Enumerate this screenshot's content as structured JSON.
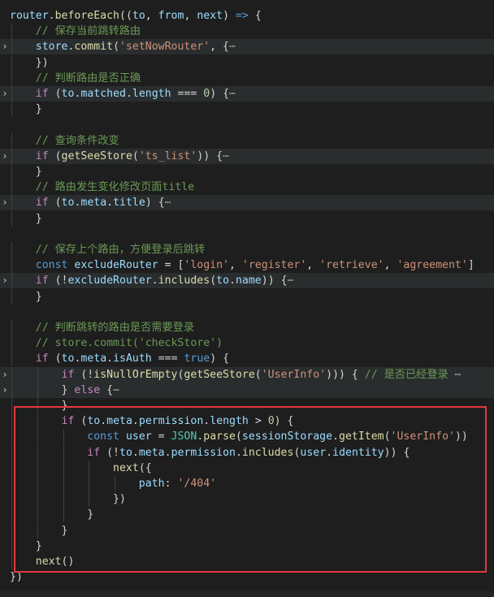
{
  "editor": {
    "lines": [
      {
        "tokens": [
          [
            "var",
            "router"
          ],
          [
            "pun",
            "."
          ],
          [
            "fn",
            "beforeEach"
          ],
          [
            "pun",
            "(("
          ],
          [
            "var",
            "to"
          ],
          [
            "pun",
            ", "
          ],
          [
            "var",
            "from"
          ],
          [
            "pun",
            ", "
          ],
          [
            "var",
            "next"
          ],
          [
            "pun",
            ") "
          ],
          [
            "kw",
            "=>"
          ],
          [
            "pun",
            " {"
          ]
        ]
      },
      {
        "tokens": [
          [
            "pun",
            "  "
          ],
          [
            "com",
            "// 保存当前跳转路由"
          ]
        ]
      },
      {
        "folded": true,
        "tokens": [
          [
            "pun",
            "  "
          ],
          [
            "var",
            "store"
          ],
          [
            "pun",
            "."
          ],
          [
            "fn",
            "commit"
          ],
          [
            "pun",
            "("
          ],
          [
            "str",
            "'setNowRouter'"
          ],
          [
            "pun",
            ", {"
          ],
          [
            "ell",
            "⋯"
          ]
        ]
      },
      {
        "tokens": [
          [
            "pun",
            "  })"
          ]
        ]
      },
      {
        "tokens": [
          [
            "pun",
            "  "
          ],
          [
            "com",
            "// 判断路由是否正确"
          ]
        ]
      },
      {
        "folded": true,
        "tokens": [
          [
            "pun",
            "  "
          ],
          [
            "ctl",
            "if"
          ],
          [
            "pun",
            " ("
          ],
          [
            "var",
            "to"
          ],
          [
            "pun",
            "."
          ],
          [
            "var",
            "matched"
          ],
          [
            "pun",
            "."
          ],
          [
            "var",
            "length"
          ],
          [
            "pun",
            " === "
          ],
          [
            "num",
            "0"
          ],
          [
            "pun",
            ") {"
          ],
          [
            "ell",
            "⋯"
          ]
        ]
      },
      {
        "tokens": [
          [
            "pun",
            "  }"
          ]
        ]
      },
      {
        "tokens": []
      },
      {
        "tokens": [
          [
            "pun",
            "  "
          ],
          [
            "com",
            "// 查询条件改变"
          ]
        ]
      },
      {
        "folded": true,
        "tokens": [
          [
            "pun",
            "  "
          ],
          [
            "ctl",
            "if"
          ],
          [
            "pun",
            " ("
          ],
          [
            "fn",
            "getSeeStore"
          ],
          [
            "pun",
            "("
          ],
          [
            "str",
            "'ts_list'"
          ],
          [
            "pun",
            ")) {"
          ],
          [
            "ell",
            "⋯"
          ]
        ]
      },
      {
        "tokens": [
          [
            "pun",
            "  }"
          ]
        ]
      },
      {
        "tokens": [
          [
            "pun",
            "  "
          ],
          [
            "com",
            "// 路由发生变化修改页面title"
          ]
        ]
      },
      {
        "folded": true,
        "tokens": [
          [
            "pun",
            "  "
          ],
          [
            "ctl",
            "if"
          ],
          [
            "pun",
            " ("
          ],
          [
            "var",
            "to"
          ],
          [
            "pun",
            "."
          ],
          [
            "var",
            "meta"
          ],
          [
            "pun",
            "."
          ],
          [
            "var",
            "title"
          ],
          [
            "pun",
            ") {"
          ],
          [
            "ell",
            "⋯"
          ]
        ]
      },
      {
        "tokens": [
          [
            "pun",
            "  }"
          ]
        ]
      },
      {
        "tokens": []
      },
      {
        "tokens": [
          [
            "pun",
            "  "
          ],
          [
            "com",
            "// 保存上个路由，方便登录后跳转"
          ]
        ]
      },
      {
        "tokens": [
          [
            "pun",
            "  "
          ],
          [
            "kw",
            "const"
          ],
          [
            "pun",
            " "
          ],
          [
            "var",
            "excludeRouter"
          ],
          [
            "pun",
            " = ["
          ],
          [
            "str",
            "'login'"
          ],
          [
            "pun",
            ", "
          ],
          [
            "str",
            "'register'"
          ],
          [
            "pun",
            ", "
          ],
          [
            "str",
            "'retrieve'"
          ],
          [
            "pun",
            ", "
          ],
          [
            "str",
            "'agreement'"
          ],
          [
            "pun",
            "]"
          ]
        ]
      },
      {
        "folded": true,
        "tokens": [
          [
            "pun",
            "  "
          ],
          [
            "ctl",
            "if"
          ],
          [
            "pun",
            " (!"
          ],
          [
            "var",
            "excludeRouter"
          ],
          [
            "pun",
            "."
          ],
          [
            "fn",
            "includes"
          ],
          [
            "pun",
            "("
          ],
          [
            "var",
            "to"
          ],
          [
            "pun",
            "."
          ],
          [
            "var",
            "name"
          ],
          [
            "pun",
            ")) {"
          ],
          [
            "ell",
            "⋯"
          ]
        ]
      },
      {
        "tokens": [
          [
            "pun",
            "  }"
          ]
        ]
      },
      {
        "tokens": []
      },
      {
        "tokens": [
          [
            "pun",
            "  "
          ],
          [
            "com",
            "// 判断跳转的路由是否需要登录"
          ]
        ]
      },
      {
        "tokens": [
          [
            "pun",
            "  "
          ],
          [
            "com",
            "// store.commit('checkStore')"
          ]
        ]
      },
      {
        "tokens": [
          [
            "pun",
            "  "
          ],
          [
            "ctl",
            "if"
          ],
          [
            "pun",
            " ("
          ],
          [
            "var",
            "to"
          ],
          [
            "pun",
            "."
          ],
          [
            "var",
            "meta"
          ],
          [
            "pun",
            "."
          ],
          [
            "var",
            "isAuth"
          ],
          [
            "pun",
            " === "
          ],
          [
            "kw",
            "true"
          ],
          [
            "pun",
            ") {"
          ]
        ]
      },
      {
        "folded": true,
        "tokens": [
          [
            "pun",
            "    "
          ],
          [
            "ctl",
            "if"
          ],
          [
            "pun",
            " (!"
          ],
          [
            "fn",
            "isNullOrEmpty"
          ],
          [
            "pun",
            "("
          ],
          [
            "fn",
            "getSeeStore"
          ],
          [
            "pun",
            "("
          ],
          [
            "str",
            "'UserInfo'"
          ],
          [
            "pun",
            "))) { "
          ],
          [
            "com",
            "// 是否已经登录"
          ],
          [
            "pun",
            " "
          ],
          [
            "ell",
            "⋯"
          ]
        ]
      },
      {
        "folded": true,
        "tokens": [
          [
            "pun",
            "    } "
          ],
          [
            "ctl",
            "else"
          ],
          [
            "pun",
            " {"
          ],
          [
            "ell",
            "⋯"
          ]
        ]
      },
      {
        "tokens": [
          [
            "pun",
            "    }"
          ]
        ]
      },
      {
        "tokens": [
          [
            "pun",
            "    "
          ],
          [
            "ctl",
            "if"
          ],
          [
            "pun",
            " ("
          ],
          [
            "var",
            "to"
          ],
          [
            "pun",
            "."
          ],
          [
            "var",
            "meta"
          ],
          [
            "pun",
            "."
          ],
          [
            "var",
            "permission"
          ],
          [
            "pun",
            "."
          ],
          [
            "var",
            "length"
          ],
          [
            "pun",
            " > "
          ],
          [
            "num",
            "0"
          ],
          [
            "pun",
            ") {"
          ]
        ]
      },
      {
        "tokens": [
          [
            "pun",
            "      "
          ],
          [
            "kw",
            "const"
          ],
          [
            "pun",
            " "
          ],
          [
            "var",
            "user"
          ],
          [
            "pun",
            " = "
          ],
          [
            "cls",
            "JSON"
          ],
          [
            "pun",
            "."
          ],
          [
            "fn",
            "parse"
          ],
          [
            "pun",
            "("
          ],
          [
            "var",
            "sessionStorage"
          ],
          [
            "pun",
            "."
          ],
          [
            "fn",
            "getItem"
          ],
          [
            "pun",
            "("
          ],
          [
            "str",
            "'UserInfo'"
          ],
          [
            "pun",
            "))"
          ]
        ]
      },
      {
        "tokens": [
          [
            "pun",
            "      "
          ],
          [
            "ctl",
            "if"
          ],
          [
            "pun",
            " (!"
          ],
          [
            "var",
            "to"
          ],
          [
            "pun",
            "."
          ],
          [
            "var",
            "meta"
          ],
          [
            "pun",
            "."
          ],
          [
            "var",
            "permission"
          ],
          [
            "pun",
            "."
          ],
          [
            "fn",
            "includes"
          ],
          [
            "pun",
            "("
          ],
          [
            "var",
            "user"
          ],
          [
            "pun",
            "."
          ],
          [
            "var",
            "identity"
          ],
          [
            "pun",
            ")) {"
          ]
        ]
      },
      {
        "tokens": [
          [
            "pun",
            "        "
          ],
          [
            "fn",
            "next"
          ],
          [
            "pun",
            "({"
          ]
        ]
      },
      {
        "tokens": [
          [
            "pun",
            "          "
          ],
          [
            "var",
            "path"
          ],
          [
            "pun",
            ": "
          ],
          [
            "str",
            "'/404'"
          ]
        ]
      },
      {
        "tokens": [
          [
            "pun",
            "        })"
          ]
        ]
      },
      {
        "tokens": [
          [
            "pun",
            "      }"
          ]
        ]
      },
      {
        "tokens": [
          [
            "pun",
            "    }"
          ]
        ]
      },
      {
        "tokens": [
          [
            "pun",
            "  }"
          ]
        ]
      },
      {
        "tokens": [
          [
            "pun",
            "  "
          ],
          [
            "fn",
            "next"
          ],
          [
            "pun",
            "()"
          ]
        ]
      },
      {
        "tokens": [
          [
            "pun",
            "})"
          ]
        ]
      }
    ],
    "fold_marker": "›"
  }
}
